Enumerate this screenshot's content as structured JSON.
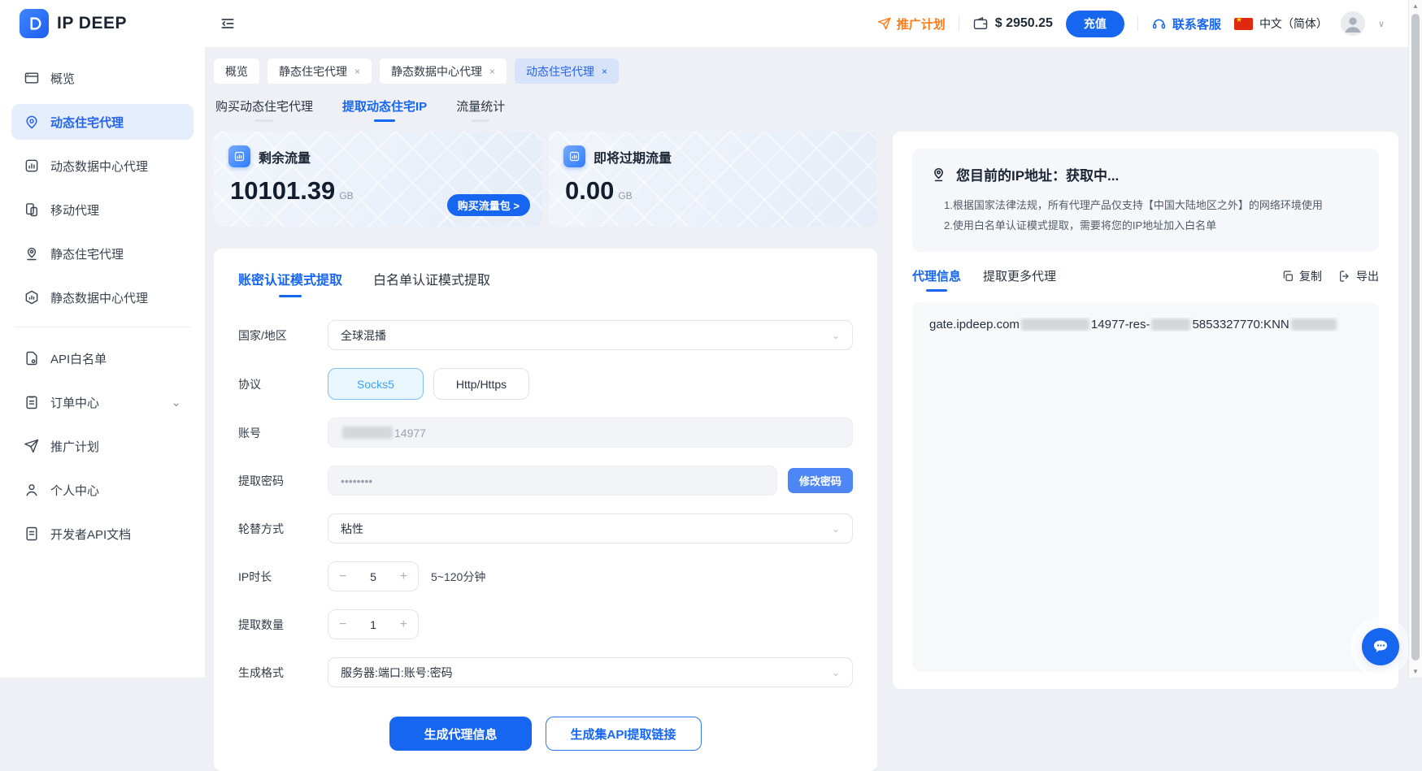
{
  "colors": {
    "primary": "#1766f0",
    "accent_orange": "#ff7d1a",
    "active_nav_bg": "#e4eefc",
    "protocol_selected": "#3da2f5"
  },
  "logo": {
    "text": "IP DEEP"
  },
  "header": {
    "promo": "推广计划",
    "balance": "$ 2950.25",
    "recharge": "充值",
    "support": "联系客服",
    "language": "中文（简体）"
  },
  "sidebar": {
    "items": [
      {
        "label": "概览"
      },
      {
        "label": "动态住宅代理"
      },
      {
        "label": "动态数据中心代理"
      },
      {
        "label": "移动代理"
      },
      {
        "label": "静态住宅代理"
      },
      {
        "label": "静态数据中心代理"
      },
      {
        "label": "API白名单"
      },
      {
        "label": "订单中心"
      },
      {
        "label": "推广计划"
      },
      {
        "label": "个人中心"
      },
      {
        "label": "开发者API文档"
      }
    ]
  },
  "workspace_tabs": [
    {
      "label": "概览"
    },
    {
      "label": "静态住宅代理",
      "close": "×"
    },
    {
      "label": "静态数据中心代理",
      "close": "×"
    },
    {
      "label": "动态住宅代理",
      "close": "×"
    }
  ],
  "subtabs": [
    {
      "label": "购买动态住宅代理"
    },
    {
      "label": "提取动态住宅IP"
    },
    {
      "label": "流量统计"
    }
  ],
  "cards": [
    {
      "title": "剩余流量",
      "value": "10101.39",
      "unit": "GB",
      "action": "购买流量包 >"
    },
    {
      "title": "即将过期流量",
      "value": "0.00",
      "unit": "GB"
    }
  ],
  "form": {
    "tab_account": "账密认证模式提取",
    "tab_whitelist": "白名单认证模式提取",
    "country_label": "国家/地区",
    "country_value": "全球混播",
    "protocol_label": "协议",
    "protocol_socks5": "Socks5",
    "protocol_http": "Http/Https",
    "account_label": "账号",
    "account_visible": "14977",
    "password_label": "提取密码",
    "password_value": "••••••••",
    "change_password": "修改密码",
    "rotation_label": "轮替方式",
    "rotation_value": "粘性",
    "duration_label": "IP时长",
    "duration_value": "5",
    "duration_hint": "5~120分钟",
    "quantity_label": "提取数量",
    "quantity_value": "1",
    "format_label": "生成格式",
    "format_value": "服务器:端口:账号:密码",
    "minus": "−",
    "plus": "+",
    "generate_proxy": "生成代理信息",
    "generate_api": "生成集API提取链接"
  },
  "right_panel": {
    "ip_title": "您目前的IP地址：获取中...",
    "note1": "1.根据国家法律法规，所有代理产品仅支持【中国大陆地区之外】的网络环境使用",
    "note2": "2.使用白名单认证模式提取，需要将您的IP地址加入白名单",
    "tab_info": "代理信息",
    "tab_more": "提取更多代理",
    "copy": "复制",
    "export": "导出",
    "proxy": {
      "seg1": "gate.ipdeep.com",
      "seg2": "14977-res-",
      "seg3": "5853327770:KNN"
    }
  }
}
